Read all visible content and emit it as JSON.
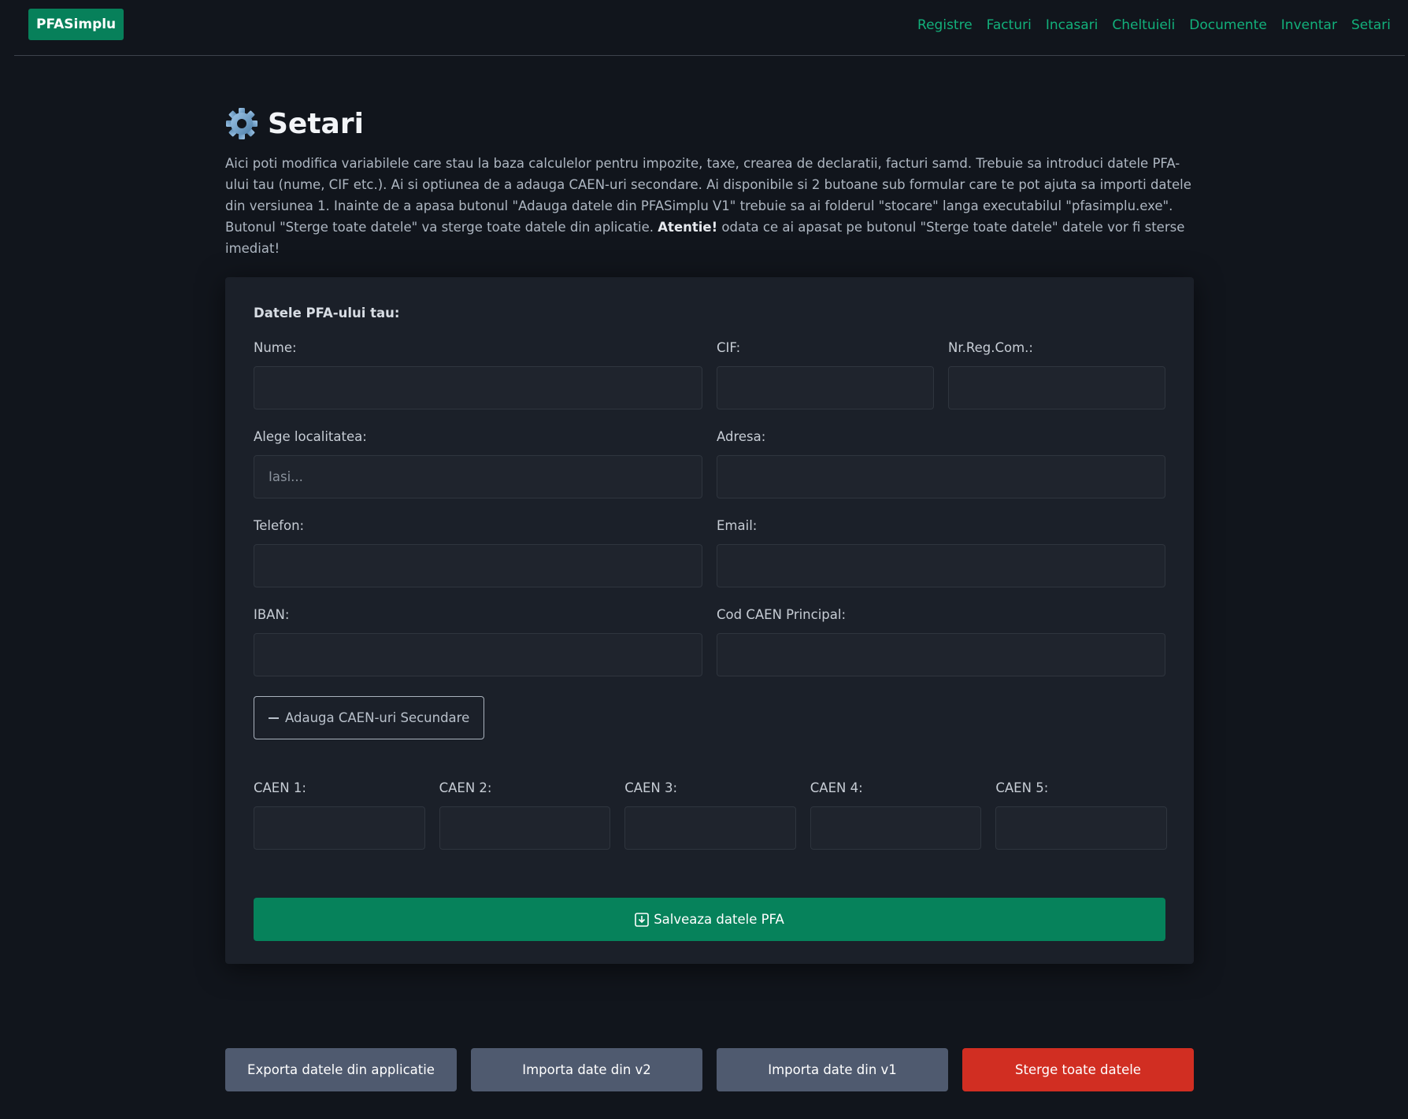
{
  "header": {
    "brand": "PFASimplu",
    "nav": [
      "Registre",
      "Facturi",
      "Incasari",
      "Cheltuieli",
      "Documente",
      "Inventar",
      "Setari"
    ],
    "link_color": "#12b07b",
    "brand_color": "#07805a"
  },
  "page": {
    "title": "Setari",
    "title_icon": "gear-icon",
    "intro_part1": "Aici poti modifica variabilele care stau la baza calculelor pentru impozite, taxe, crearea de declaratii, facturi samd. Trebuie sa introduci datele PFA-ului tau (nume, CIF etc.). Ai si optiunea de a adauga CAEN-uri secondare. Ai disponibile si 2 butoane sub formular care te pot ajuta sa importi datele din versiunea 1. Inainte de a apasa butonul \"Adauga datele din PFASimplu V1\" trebuie sa ai folderul \"stocare\" langa executabilul \"pfasimplu.exe\". Butonul \"Sterge toate datele\" va sterge toate datele din aplicatie.",
    "intro_bold": "Atentie!",
    "intro_part2": "odata ce ai apasat pe butonul \"Sterge toate datele\" datele vor fi sterse imediat!"
  },
  "form": {
    "section_title": "Datele PFA-ului tau:",
    "nume": {
      "label": "Nume:",
      "value": ""
    },
    "cif": {
      "label": "CIF:",
      "value": ""
    },
    "nr_reg_com": {
      "label": "Nr.Reg.Com.:",
      "value": ""
    },
    "localitate": {
      "label": "Alege localitatea:",
      "placeholder": "Iasi..."
    },
    "adresa": {
      "label": "Adresa:",
      "value": ""
    },
    "telefon": {
      "label": "Telefon:",
      "value": ""
    },
    "email": {
      "label": "Email:",
      "value": ""
    },
    "iban": {
      "label": "IBAN:",
      "value": ""
    },
    "caen_principal": {
      "label": "Cod CAEN Principal:",
      "value": ""
    },
    "add_caen_button": "Adauga CAEN-uri Secundare",
    "caen": [
      {
        "label": "CAEN 1:",
        "value": ""
      },
      {
        "label": "CAEN 2:",
        "value": ""
      },
      {
        "label": "CAEN 3:",
        "value": ""
      },
      {
        "label": "CAEN 4:",
        "value": ""
      },
      {
        "label": "CAEN 5:",
        "value": ""
      }
    ],
    "save_button": "Salveaza datele PFA",
    "save_color": "#06825b"
  },
  "actions": {
    "export": "Exporta datele din applicatie",
    "import_v2": "Importa date din v2",
    "import_v1": "Importa date din v1",
    "delete_all": "Sterge toate datele",
    "gray_color": "#4f5a6f",
    "danger_color": "#d12e22"
  }
}
